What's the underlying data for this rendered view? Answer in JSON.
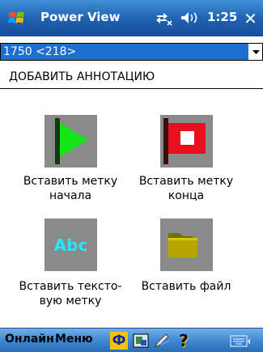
{
  "titlebar": {
    "title": "Power View",
    "clock": "1:25",
    "close": "✕"
  },
  "dropdown": {
    "selected": "1750 <218>"
  },
  "section": {
    "header": "ДОБАВИТЬ АННОТАЦИЮ"
  },
  "items": [
    {
      "label_line1": "Вставить метку",
      "label_line2": "начала",
      "icon": "green-play-flag-icon"
    },
    {
      "label_line1": "Вставить метку",
      "label_line2": "конца",
      "icon": "red-stop-flag-icon"
    },
    {
      "label_line1": "Вставить тексто-",
      "label_line2": "вую метку",
      "icon": "abc-text-icon",
      "tile_text": "Abc"
    },
    {
      "label_line1": "Вставить файл",
      "label_line2": "",
      "icon": "folder-icon"
    }
  ],
  "bottombar": {
    "online_label": "Онлайн",
    "menu_label": "Меню",
    "app_glyph": "Ф",
    "help_glyph": "?"
  },
  "colors": {
    "titlebar": "#1f5fb0",
    "selection": "#1d6fd0",
    "tile": "#8a8a8a",
    "play_green": "#14e41a",
    "stop_red": "#e8101c",
    "abc_cyan": "#29e4ff",
    "folder_yellow": "#b8a600"
  }
}
